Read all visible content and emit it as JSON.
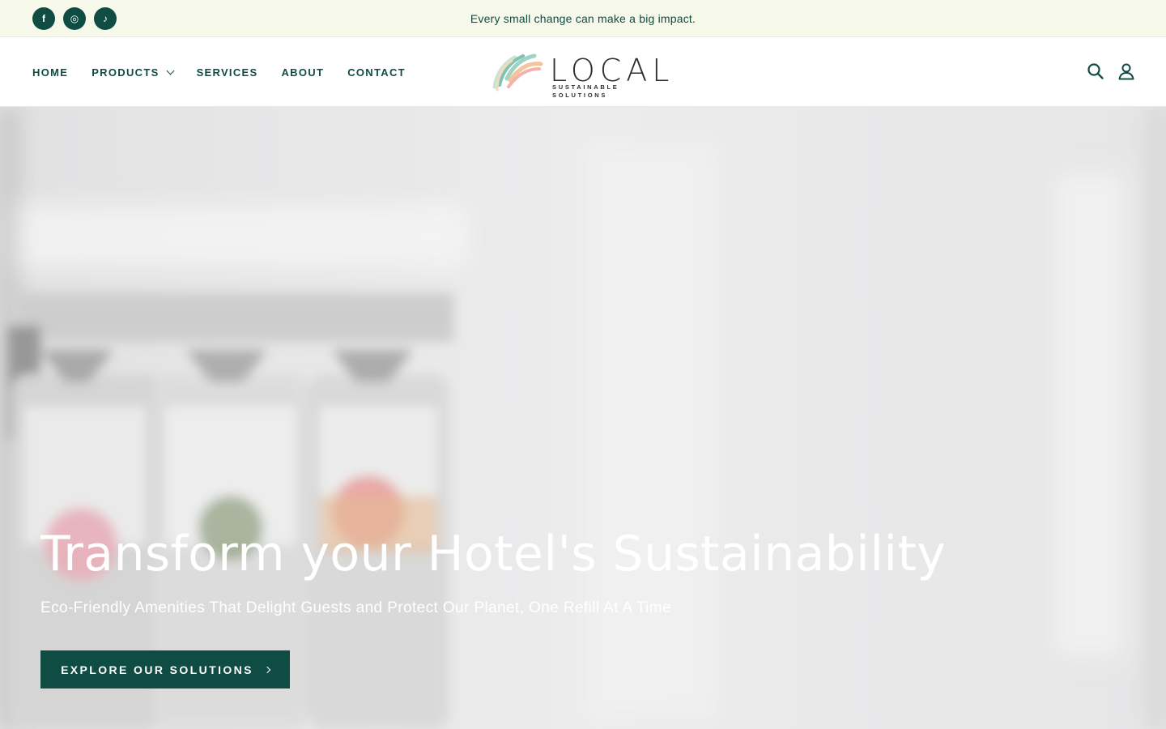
{
  "announcement": {
    "text": "Every small change can make a big impact.",
    "socials": [
      {
        "icon": "facebook-icon",
        "glyph": "f"
      },
      {
        "icon": "instagram-icon",
        "glyph": "◎"
      },
      {
        "icon": "tiktok-icon",
        "glyph": "♪"
      }
    ]
  },
  "nav": {
    "items": [
      {
        "label": "HOME"
      },
      {
        "label": "PRODUCTS",
        "has_dropdown": true
      },
      {
        "label": "SERVICES"
      },
      {
        "label": "ABOUT"
      },
      {
        "label": "CONTACT"
      }
    ]
  },
  "logo": {
    "wordmark": "LOCAL",
    "tagline": "SUSTAINABLE SOLUTIONS"
  },
  "header_icons": [
    "search-icon",
    "account-icon"
  ],
  "hero": {
    "title": "Transform your Hotel's Sustainability",
    "subtitle": "Eco-Friendly Amenities That Delight Guests and Protect Our Planet, One Refill At A Time",
    "cta_label": "EXPLORE OUR SOLUTIONS"
  },
  "colors": {
    "brand_dark_green": "#0f4c44",
    "announcement_bg": "#f6f8ea",
    "logo_text": "#2a2f35",
    "hero_bg": "#e8e8e9"
  }
}
